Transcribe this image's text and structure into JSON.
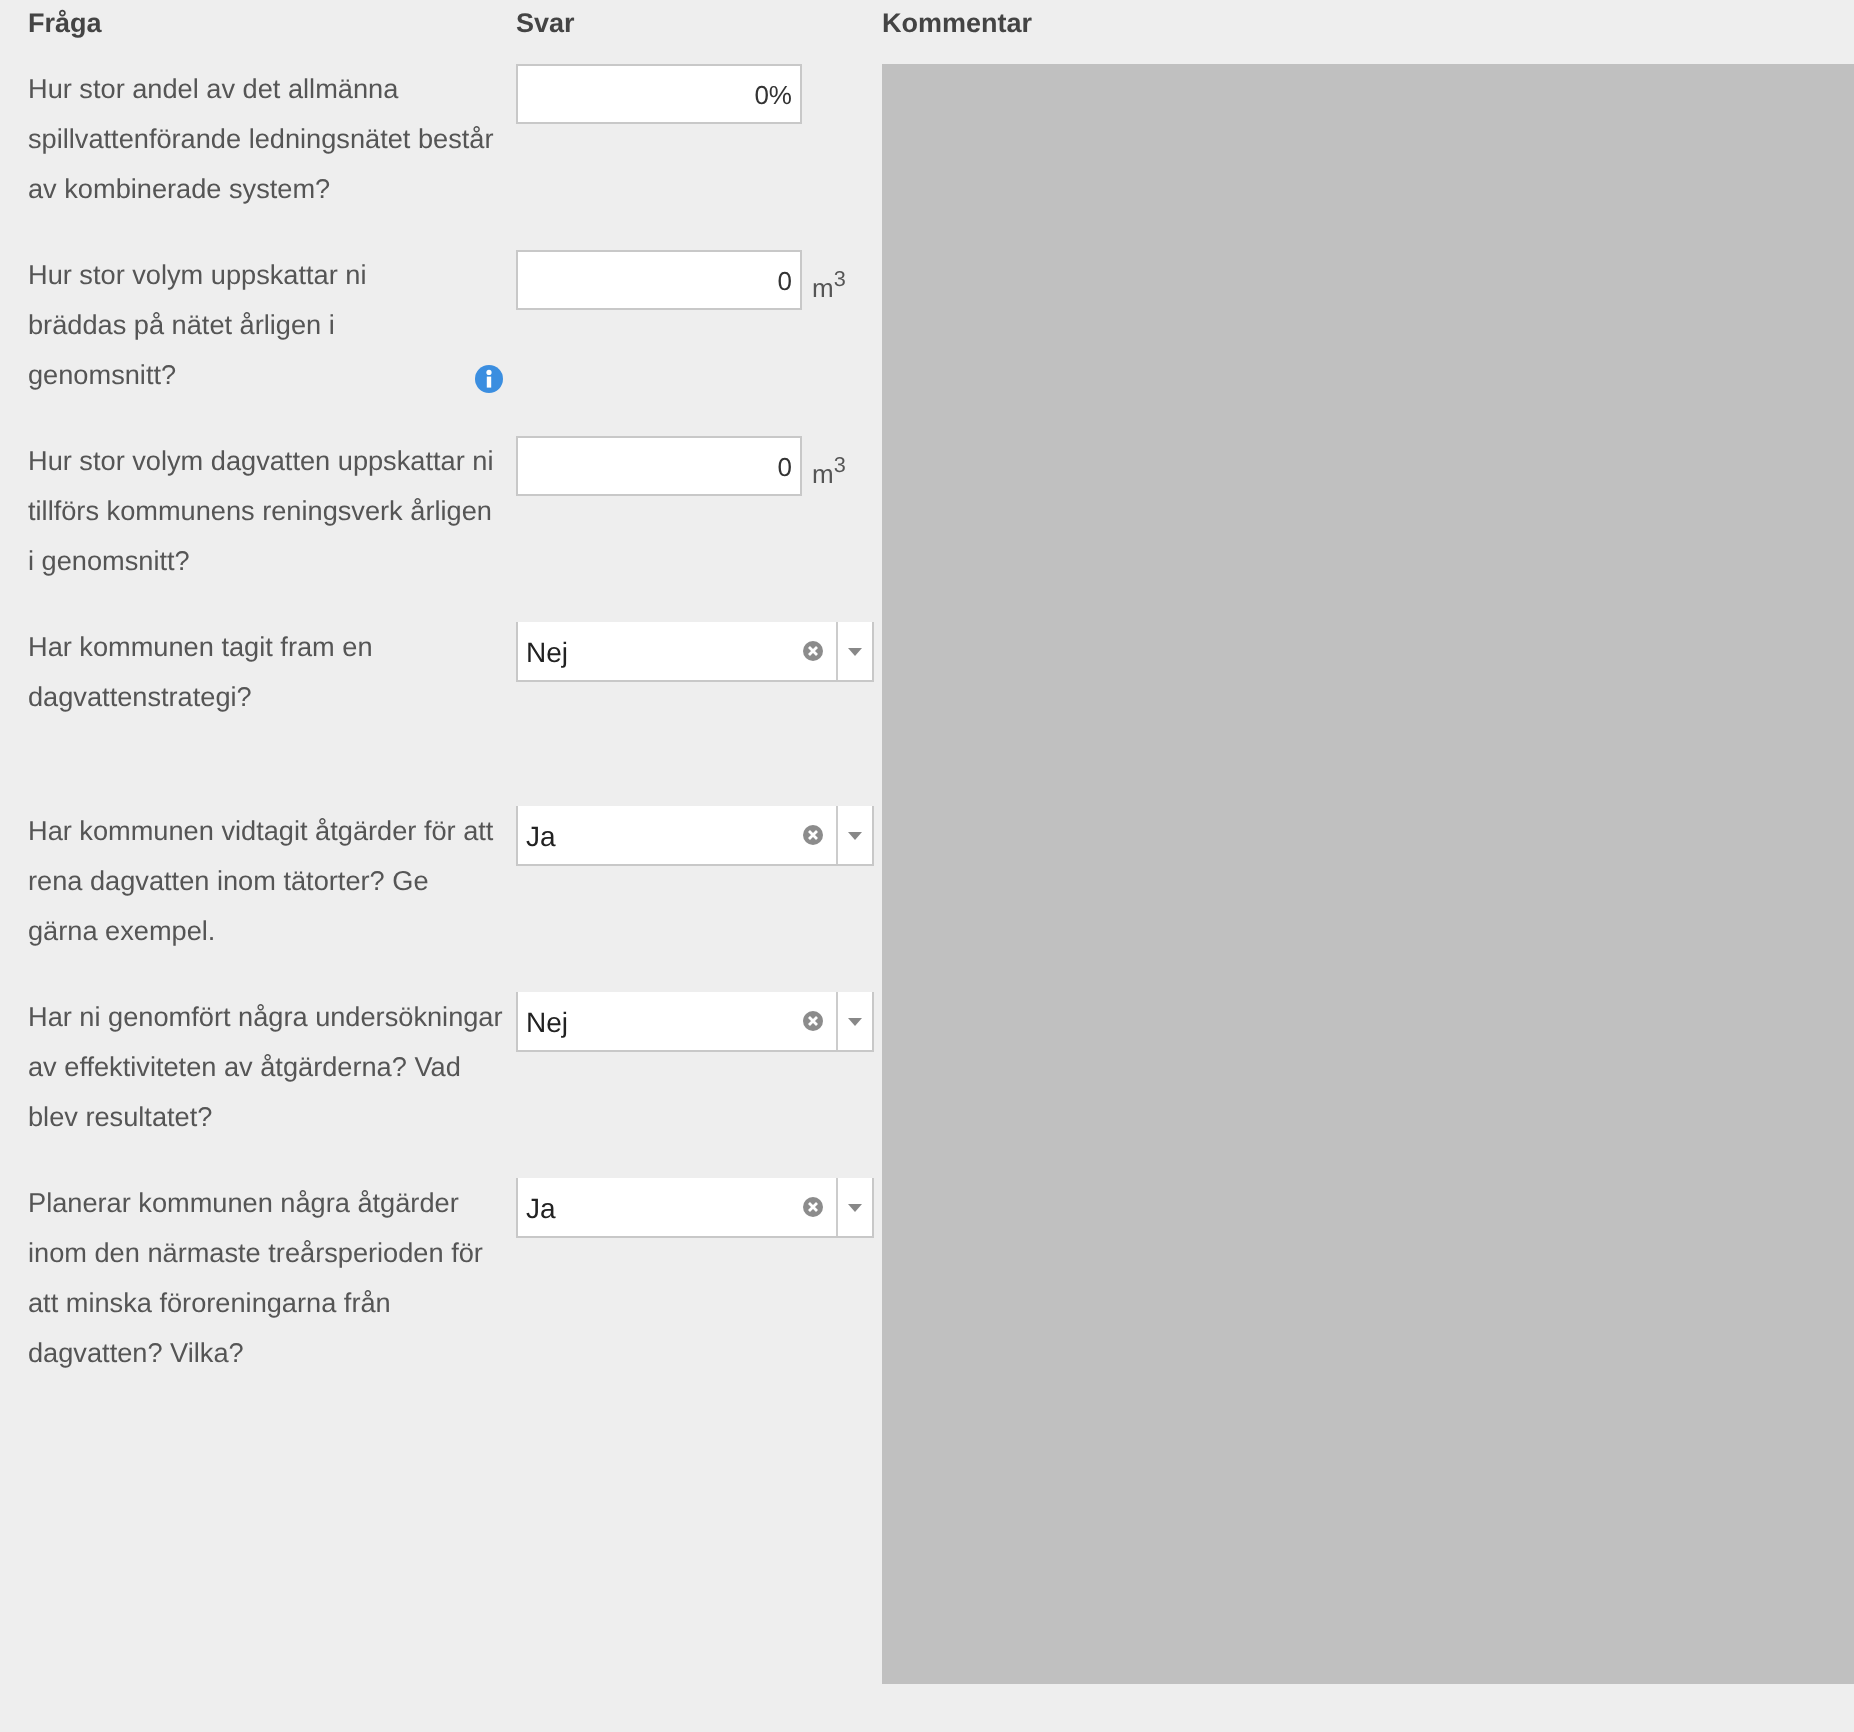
{
  "columns": [
    "Fråga",
    "Svar",
    "Kommentar"
  ],
  "questions": [
    {
      "text": "Hur stor andel av det allmänna spillvattenförande ledningsnätet består av kombinerade system?",
      "info": false,
      "answer": {
        "kind": "number",
        "value": "0%"
      }
    },
    {
      "text": "Hur stor volym uppskattar ni bräddas på nätet årligen i genomsnitt?",
      "info": true,
      "answer": {
        "kind": "number",
        "value": "0",
        "unit": "m$^{3}$"
      }
    },
    {
      "text": "Hur stor volym dagvatten uppskattar ni tillförs kommunens reningsverk årligen i genomsnitt?",
      "info": false,
      "answer": {
        "kind": "number",
        "value": "0",
        "unit": "m$^{3}$"
      }
    },
    {
      "text": "Har kommunen tagit fram en dagvattenstrategi?",
      "info": false,
      "answer": {
        "kind": "select",
        "value": "Nej"
      }
    },
    {
      "text": "Har kommunen vidtagit åtgärder för att rena dagvatten inom tätorter? Ge gärna exempel.",
      "info": false,
      "answer": {
        "kind": "select",
        "value": "Ja"
      }
    },
    {
      "text": "Har ni genomfört några undersökningar av effektiviteten av åtgärderna? Vad blev resultatet?",
      "info": false,
      "answer": {
        "kind": "select",
        "value": "Nej"
      }
    },
    {
      "text": "Planerar kommunen några åtgärder inom den närmaste treårsperioden för att minska föroreningarna från dagvatten? Vilka?",
      "info": false,
      "answer": {
        "kind": "select",
        "value": "Ja"
      }
    }
  ]
}
